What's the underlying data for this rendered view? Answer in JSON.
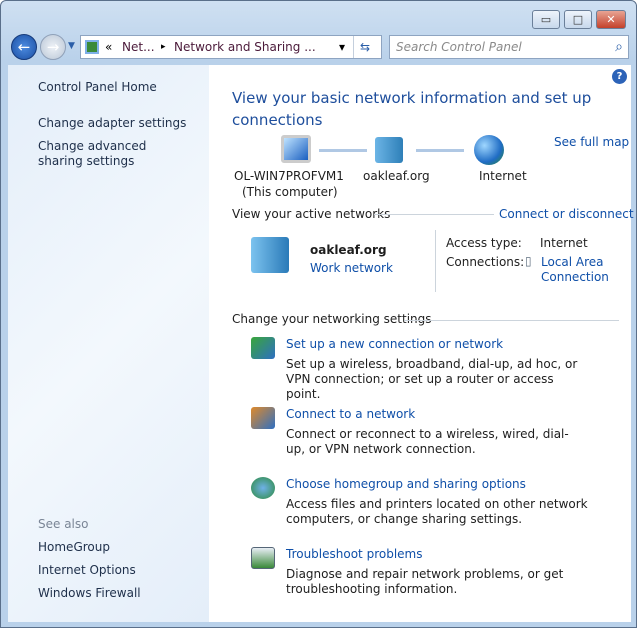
{
  "window": {
    "min": "▭",
    "max": "□",
    "close": "✕"
  },
  "address": {
    "chevrons": "«",
    "crumb1": "Net...",
    "sep": "▸",
    "crumb2": "Network and Sharing ...",
    "dropdown": "▾",
    "refresh": "⇆"
  },
  "search": {
    "placeholder": "Search Control Panel",
    "icon": "⌕"
  },
  "help": "?",
  "sidebar": {
    "home": "Control Panel Home",
    "items": [
      "Change adapter settings",
      "Change advanced sharing settings"
    ],
    "see_also": "See also",
    "also": [
      "HomeGroup",
      "Internet Options",
      "Windows Firewall"
    ]
  },
  "main": {
    "title": "View your basic network information and set up connections",
    "see_full_map": "See full map",
    "map": {
      "computer": "OL-WIN7PROFVM1",
      "computer_sub": "(This computer)",
      "network": "oakleaf.org",
      "internet": "Internet"
    },
    "active_header": "View your active networks",
    "connect_link": "Connect or disconnect",
    "active": {
      "name": "oakleaf.org",
      "type": "Work network",
      "access_label": "Access type:",
      "access_value": "Internet",
      "conn_label": "Connections:",
      "conn_value": "Local Area Connection"
    },
    "change_header": "Change your networking settings",
    "tasks": [
      {
        "title": "Set up a new connection or network",
        "desc": "Set up a wireless, broadband, dial-up, ad hoc, or VPN connection; or set up a router or access point."
      },
      {
        "title": "Connect to a network",
        "desc": "Connect or reconnect to a wireless, wired, dial-up, or VPN network connection."
      },
      {
        "title": "Choose homegroup and sharing options",
        "desc": "Access files and printers located on other network computers, or change sharing settings."
      },
      {
        "title": "Troubleshoot problems",
        "desc": "Diagnose and repair network problems, or get troubleshooting information."
      }
    ]
  }
}
